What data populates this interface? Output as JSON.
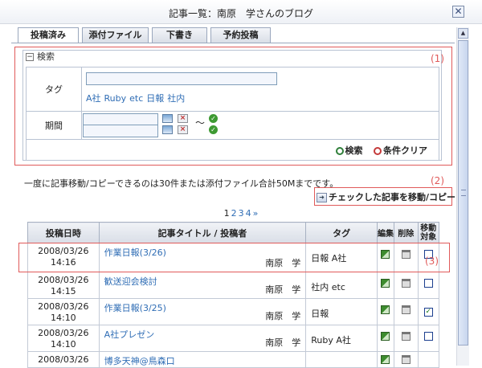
{
  "window": {
    "title": "記事一覧：南原　学さんのブログ",
    "close_symbol": "✕"
  },
  "tabs": [
    {
      "label": "投稿済み",
      "active": true
    },
    {
      "label": "添付ファイル",
      "active": false
    },
    {
      "label": "下書き",
      "active": false
    },
    {
      "label": "予約投稿",
      "active": false
    }
  ],
  "search": {
    "legend": "検索",
    "tag_label": "タグ",
    "tag_value": "",
    "tag_suggestions": [
      "A社",
      "Ruby",
      "etc",
      "日報",
      "社内"
    ],
    "period_label": "期間",
    "period_from": "",
    "period_to": "",
    "tilde": "～",
    "search_button": "検索",
    "clear_button": "条件クリア"
  },
  "annotations": {
    "n1": "(1)",
    "n2": "(2)",
    "n3": "(3)"
  },
  "notice": "一度に記事移動/コピーできるのは30件または添付ファイル合計50Mまでです。",
  "move_button": "チェックした記事を移動/コピー",
  "pagination": {
    "current": "1",
    "pages": [
      "2",
      "3",
      "4"
    ],
    "next": "»"
  },
  "table": {
    "headers": {
      "date": "投稿日時",
      "title": "記事タイトル / 投稿者",
      "tag": "タグ",
      "edit": "編集",
      "delete": "削除",
      "move": "移動対象"
    },
    "rows": [
      {
        "date": "2008/03/26",
        "time": "14:16",
        "title": "作業日報(3/26)",
        "author": "南原　学",
        "tag": "日報 A社",
        "checked": false
      },
      {
        "date": "2008/03/26",
        "time": "14:15",
        "title": "歓送迎会検討",
        "author": "南原　学",
        "tag": "社内 etc",
        "checked": false
      },
      {
        "date": "2008/03/26",
        "time": "14:10",
        "title": "作業日報(3/25)",
        "author": "南原　学",
        "tag": "日報",
        "checked": true
      },
      {
        "date": "2008/03/26",
        "time": "14:10",
        "title": "A社プレゼン",
        "author": "南原　学",
        "tag": "Ruby A社",
        "checked": false
      },
      {
        "date": "2008/03/26",
        "time": "",
        "title": "博多天神@鳥森口",
        "author": "",
        "tag": "",
        "checked": false
      }
    ]
  }
}
